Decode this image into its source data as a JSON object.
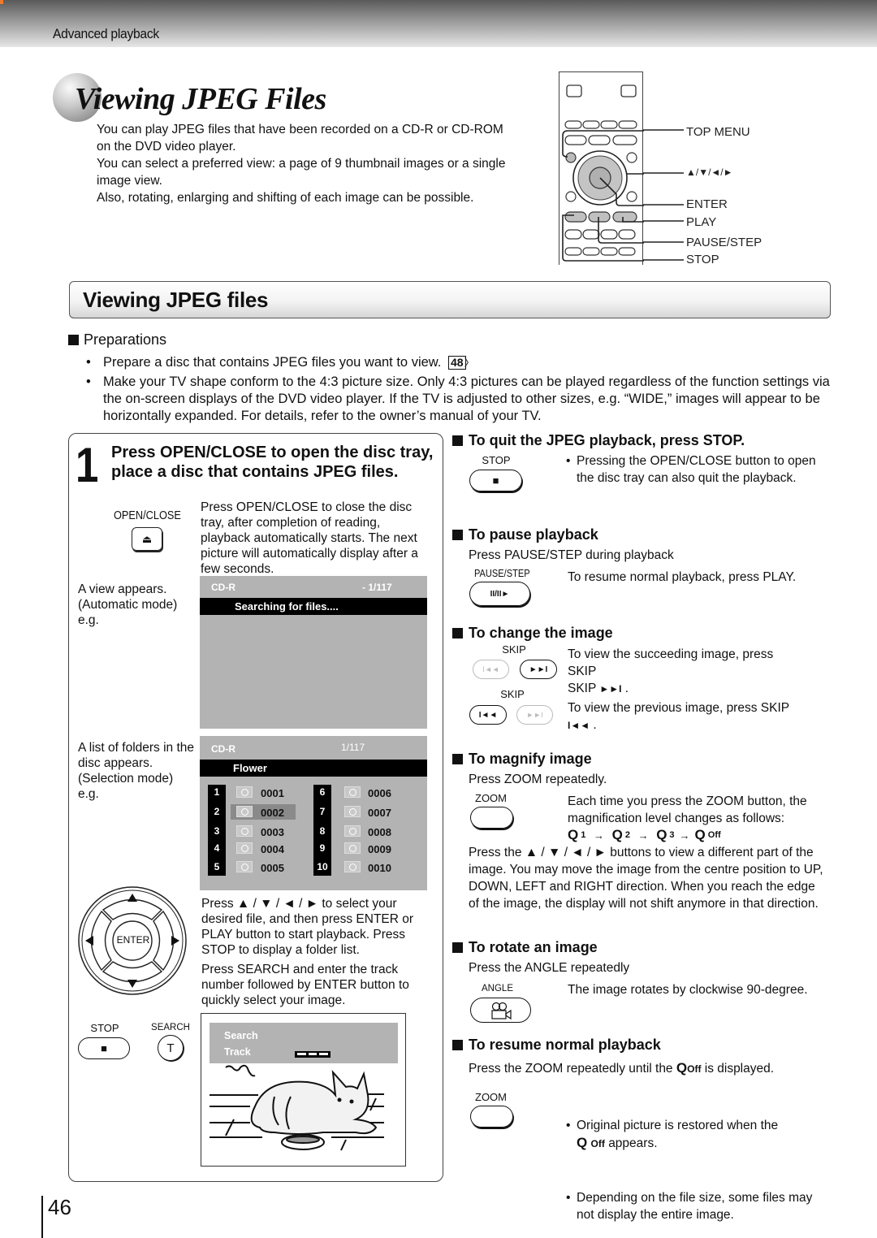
{
  "header": {
    "section": "Advanced playback"
  },
  "title": {
    "main": "Viewing JPEG Files",
    "intro": [
      "You can play JPEG files that have been recorded on a CD-R or CD-ROM on the DVD video player.",
      "You can select a preferred view: a page of 9 thumbnail images or a single image view.",
      "Also, rotating, enlarging and shifting of each image can be possible."
    ]
  },
  "remote_labels": {
    "top_menu": "TOP MENU",
    "arrows": "▲/▼/◄/►",
    "enter": "ENTER",
    "play": "PLAY",
    "pause_step": "PAUSE/STEP",
    "stop": "STOP"
  },
  "section": {
    "title": "Viewing JPEG files",
    "preparations_heading": "Preparations",
    "preparations": [
      {
        "text": "Prepare a disc that contains JPEG files you want to view.",
        "ref": "48"
      },
      {
        "text": "Make your TV shape conform to the 4:3 picture size.  Only 4:3 pictures can be played regardless of the function settings via the on-screen displays of the DVD video player.  If the TV is adjusted to other sizes, e.g. “WIDE,” images will appear to be horizontally expanded. For details, refer to the owner’s manual of your TV."
      }
    ]
  },
  "step1": {
    "number": "1",
    "heading": "Press OPEN/CLOSE to open the disc tray, place a disc that contains JPEG files.",
    "open_close_label": "OPEN/CLOSE",
    "eject_icon": "⏏",
    "open_close_text": "Press OPEN/CLOSE to close the disc tray, after completion of reading, playback automatically starts. The next picture will automatically display after a few seconds.",
    "auto_caption": "A view appears. (Automatic mode) e.g.",
    "auto_osd": {
      "disc": "CD-R",
      "counter": "- 1/117",
      "status": "Searching for files...."
    },
    "select_caption": "A list of folders in the disc appears. (Selection mode) e.g.",
    "select_osd": {
      "disc": "CD-R",
      "counter": "1/117",
      "folder": "Flower",
      "selected_index": 1,
      "files_left": [
        {
          "num": "1",
          "name": "0001"
        },
        {
          "num": "2",
          "name": "0002"
        },
        {
          "num": "3",
          "name": "0003"
        },
        {
          "num": "4",
          "name": "0004"
        },
        {
          "num": "5",
          "name": "0005"
        }
      ],
      "files_right": [
        {
          "num": "6",
          "name": "0006"
        },
        {
          "num": "7",
          "name": "0007"
        },
        {
          "num": "8",
          "name": "0008"
        },
        {
          "num": "9",
          "name": "0009"
        },
        {
          "num": "10",
          "name": "0010"
        }
      ]
    },
    "enter_label": "ENTER",
    "nav_text": "Press ▲ / ▼ / ◄ / ► to select your desired file, and then press ENTER or PLAY button to start playback. Press STOP to display a folder list.",
    "search_text": "Press SEARCH and enter the track number followed by ENTER button to quickly select your image.",
    "stop_label": "STOP",
    "stop_icon": "■",
    "search_label": "SEARCH",
    "search_icon": "T",
    "search_osd": {
      "line1": "Search",
      "line2": "Track"
    }
  },
  "right": {
    "quit": {
      "heading": "To quit the JPEG playback, press STOP.",
      "btn_label": "STOP",
      "btn_icon": "■",
      "note": "Pressing the OPEN/CLOSE button to open the disc tray can also quit the playback."
    },
    "pause": {
      "heading": "To pause playback",
      "instruction": "Press PAUSE/STEP during playback",
      "btn_label": "PAUSE/STEP",
      "btn_icon": "II/II►",
      "note": "To resume normal playback, press PLAY."
    },
    "change": {
      "heading": "To change the image",
      "skip_label": "SKIP",
      "next_icon": "►►I",
      "prev_icon": "I◄◄",
      "next_text": "To view the succeeding image, press SKIP",
      "prev_text": "To view the previous image, press SKIP"
    },
    "magnify": {
      "heading": "To magnify image",
      "instruction": "Press ZOOM repeatedly.",
      "btn_label": "ZOOM",
      "note": "Each time you press the ZOOM button, the magnification level changes as follows:",
      "levels": [
        "1",
        "2",
        "3",
        "Off"
      ],
      "pan_text": "Press the ▲ / ▼ / ◄ / ►  buttons to view a different part of the image. You may move the image from the centre position to UP, DOWN, LEFT and RIGHT direction.  When you reach the edge of the image, the display will not shift anymore in that direction."
    },
    "rotate": {
      "heading": "To rotate an image",
      "instruction": "Press the ANGLE repeatedly",
      "btn_label": "ANGLE",
      "note": "The image rotates by clockwise 90-degree."
    },
    "resume": {
      "heading": "To resume normal playback",
      "instruction_pre": "Press the ZOOM repeatedly until the",
      "instruction_off": "Off",
      "instruction_post": "is displayed.",
      "btn_label": "ZOOM",
      "note1_pre": "Original picture is restored when the",
      "note1_off": "Off",
      "note1_post": "appears.",
      "note2": "Depending on the file size, some files may not display the entire image."
    }
  },
  "footer": {
    "page_number": "46"
  }
}
